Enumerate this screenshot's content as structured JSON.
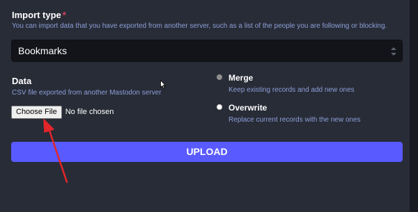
{
  "import": {
    "title": "Import type",
    "required_mark": "*",
    "hint": "You can import data that you have exported from another server, such as a list of the people you are following or blocking.",
    "selected": "Bookmarks"
  },
  "data_field": {
    "title": "Data",
    "hint": "CSV file exported from another Mastodon server",
    "choose_file_label": "Choose File",
    "file_status": "No file chosen"
  },
  "mode": {
    "options": [
      {
        "label": "Merge",
        "hint": "Keep existing records and add new ones",
        "checked": true
      },
      {
        "label": "Overwrite",
        "hint": "Replace current records with the new ones",
        "checked": false
      }
    ]
  },
  "upload_label": "UPLOAD",
  "icons": {
    "select": "chevron-up-down-icon",
    "cursor": "mouse-cursor-icon",
    "annotation": "red-arrow-annotation"
  },
  "colors": {
    "panel_bg": "#282c37",
    "page_bg": "#191b22",
    "input_bg": "#131419",
    "accent": "#595aff",
    "hint": "#8d9fd8",
    "required": "#df405a",
    "annotation": "#e2262b"
  }
}
